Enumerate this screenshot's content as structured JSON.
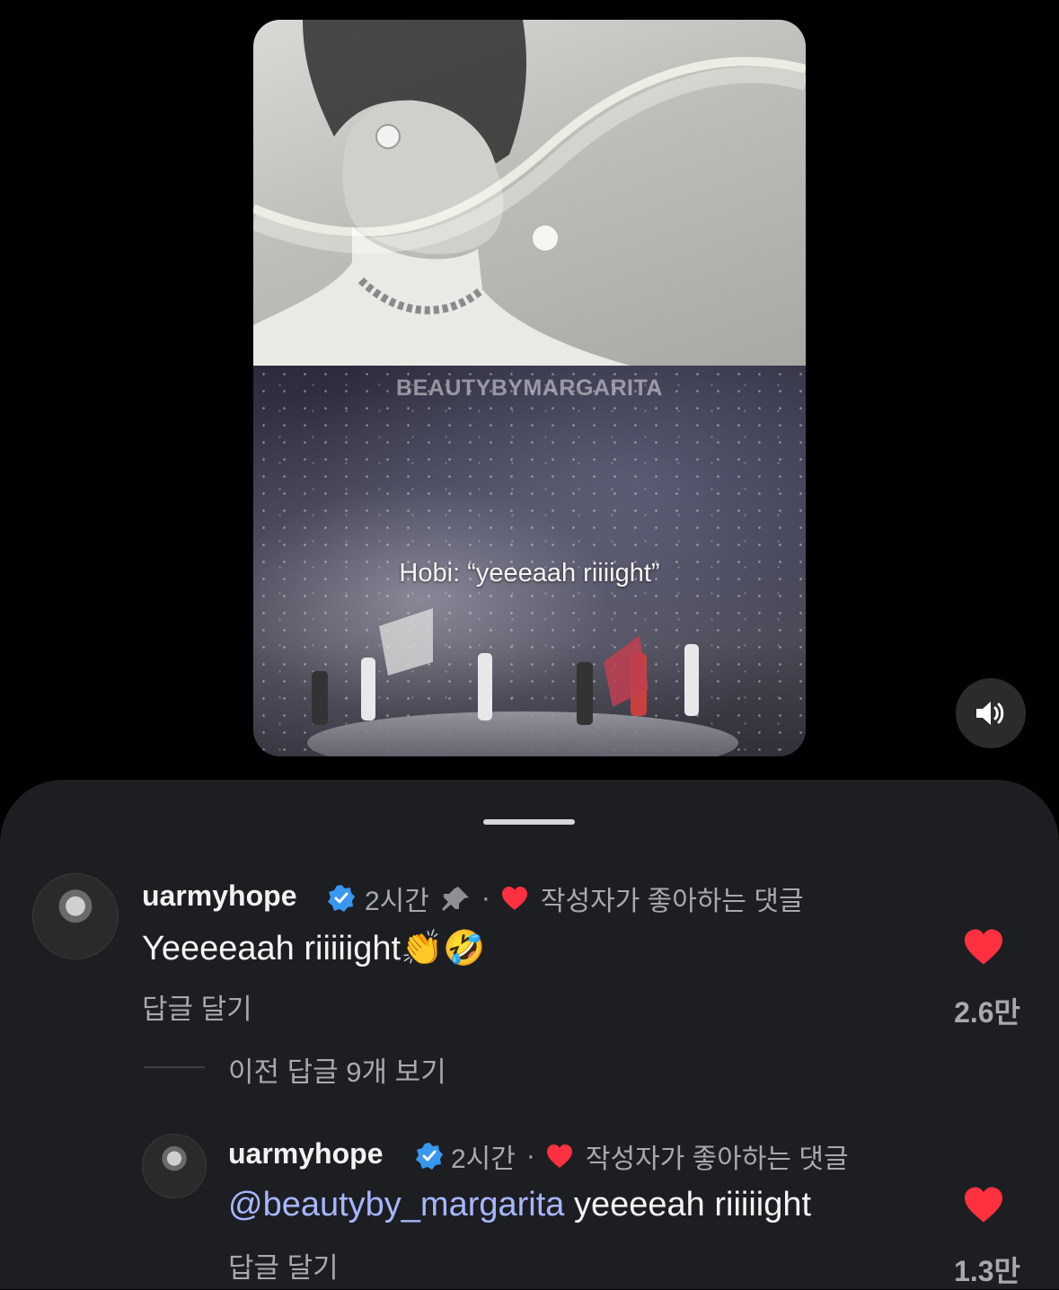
{
  "video": {
    "watermark": "BEAUTYBYMARGARITA",
    "caption": "Hobi: “yeeeaah riiiight”"
  },
  "comments": [
    {
      "username": "uarmyhope",
      "time": "2시간",
      "sep": "·",
      "creator_liked": "작성자가 좋아하는 댓글",
      "text": "Yeeeeaah riiiiight👏🤣",
      "reply_label": "답글 달기",
      "likes": "2.6만"
    }
  ],
  "view_more": "이전 답글 9개 보기",
  "replies": [
    {
      "username": "uarmyhope",
      "time": "2시간",
      "sep": "·",
      "creator_liked": "작성자가 좋아하는 댓글",
      "mention": "@beautyby_margarita",
      "text": " yeeeeah riiiiight",
      "reply_label": "답글 달기",
      "likes": "1.3만"
    }
  ],
  "colors": {
    "background": "#000000",
    "sheet": "#1d1e22",
    "verified": "#3897f0",
    "heart": "#ff3040",
    "mention": "#a6b6ff"
  },
  "icons": [
    "speaker-icon",
    "verified-badge-icon",
    "pin-icon",
    "heart-icon"
  ]
}
